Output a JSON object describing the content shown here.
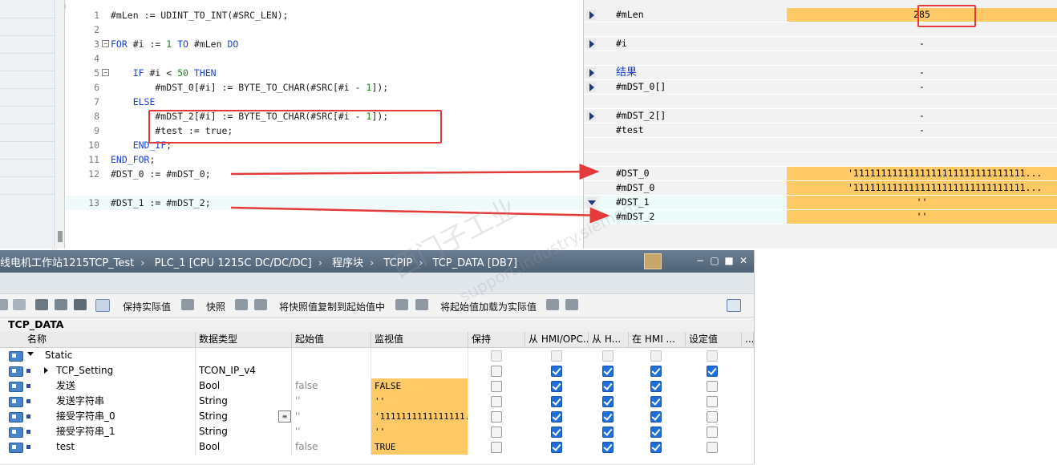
{
  "code": {
    "lines": [
      {
        "n": "1",
        "text": "#mLen := UDINT_TO_INT(#SRC_LEN);"
      },
      {
        "n": "2",
        "text": ""
      },
      {
        "n": "3",
        "text": "FOR #i := 1 TO #mLen DO"
      },
      {
        "n": "4",
        "text": ""
      },
      {
        "n": "5",
        "text": "    IF #i < 50 THEN"
      },
      {
        "n": "6",
        "text": "        #mDST_0[#i] := BYTE_TO_CHAR(#SRC[#i - 1]);"
      },
      {
        "n": "7",
        "text": "    ELSE"
      },
      {
        "n": "8",
        "text": "        #mDST_2[#i] := BYTE_TO_CHAR(#SRC[#i - 1]);"
      },
      {
        "n": "9",
        "text": "        #test := true;"
      },
      {
        "n": "10",
        "text": "    END_IF;"
      },
      {
        "n": "11",
        "text": "END_FOR;"
      },
      {
        "n": "12",
        "text": "#DST_0 := #mDST_0;"
      },
      {
        "n": "13",
        "text": "#DST_1 := #mDST_2;"
      }
    ]
  },
  "watch": {
    "rows": [
      {
        "name": "#mLen",
        "value": "285"
      },
      {
        "name": "",
        "value": ""
      },
      {
        "name": "#i",
        "value": "-"
      },
      {
        "name": "",
        "value": ""
      },
      {
        "name": "结果",
        "value": "-"
      },
      {
        "name": "#mDST_0[]",
        "value": "-"
      },
      {
        "name": "",
        "value": ""
      },
      {
        "name": "#mDST_2[]",
        "value": "-"
      },
      {
        "name": "#test",
        "value": "-"
      },
      {
        "name": "",
        "value": ""
      },
      {
        "name": "",
        "value": ""
      },
      {
        "name": "#DST_0",
        "value": "'1111111111111111111111111111111..."
      },
      {
        "name": "#mDST_0",
        "value": "'1111111111111111111111111111111..."
      },
      {
        "name": "#DST_1",
        "value": "''"
      },
      {
        "name": "#mDST_2",
        "value": "''"
      }
    ]
  },
  "editor": {
    "breadcrumb": [
      "线电机工作站1215TCP_Test",
      "PLC_1 [CPU 1215C DC/DC/DC]",
      "程序块",
      "TCPIP",
      "TCP_DATA [DB7]"
    ],
    "separator": "›",
    "controls": {
      "minimize": "−",
      "restore": "▢",
      "maximize": "■",
      "close": "✕"
    }
  },
  "toolbar": {
    "keep_actual": "保持实际值",
    "snapshot": "快照",
    "copy_snapshot": "将快照值复制到起始值中",
    "load_start": "将起始值加载为实际值"
  },
  "db_name": "TCP_DATA",
  "grid": {
    "columns": [
      "名称",
      "数据类型",
      "起始值",
      "监视值",
      "保持",
      "从 HMI/OPC...",
      "从 H...",
      "在 HMI ...",
      "设定值",
      "..."
    ],
    "rows": [
      {
        "name": "Static",
        "type": "",
        "start": "",
        "monitor": "",
        "retain": "dis",
        "hmi1": "dis",
        "hmi2": "dis",
        "hmi3": "dis",
        "setp": "dis"
      },
      {
        "name": "TCP_Setting",
        "type": "TCON_IP_v4",
        "start": "",
        "monitor": "",
        "retain": "gray",
        "hmi1": "on",
        "hmi2": "on",
        "hmi3": "on",
        "setp": "on"
      },
      {
        "name": "发送",
        "type": "Bool",
        "start": "false",
        "monitor": "FALSE",
        "retain": "gray",
        "hmi1": "on",
        "hmi2": "on",
        "hmi3": "on",
        "setp": "gray"
      },
      {
        "name": "发送字符串",
        "type": "String",
        "start": "''",
        "monitor": "''",
        "retain": "gray",
        "hmi1": "on",
        "hmi2": "on",
        "hmi3": "on",
        "setp": "gray"
      },
      {
        "name": "接受字符串_0",
        "type": "String",
        "start": "''",
        "monitor": "'1111111111111111...",
        "retain": "gray",
        "hmi1": "on",
        "hmi2": "on",
        "hmi3": "on",
        "setp": "gray"
      },
      {
        "name": "接受字符串_1",
        "type": "String",
        "start": "''",
        "monitor": "''",
        "retain": "gray",
        "hmi1": "on",
        "hmi2": "on",
        "hmi3": "on",
        "setp": "gray"
      },
      {
        "name": "test",
        "type": "Bool",
        "start": "false",
        "monitor": "TRUE",
        "retain": "gray",
        "hmi1": "on",
        "hmi2": "on",
        "hmi3": "on",
        "setp": "gray"
      }
    ]
  },
  "colors": {
    "monitor_orange": "#ffc966",
    "annotation_red": "#e53a3a",
    "keyword_blue": "#1a3fd1"
  }
}
